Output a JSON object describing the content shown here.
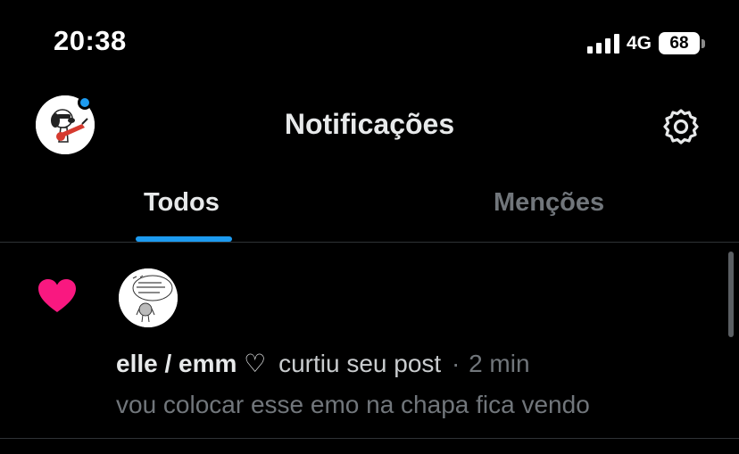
{
  "status_bar": {
    "time": "20:38",
    "network": "4G",
    "battery": "68"
  },
  "header": {
    "title": "Notificações",
    "avatar_icon": "snoopy-guitar-avatar",
    "settings_icon": "gear-icon",
    "accent_color": "#1d9bf0"
  },
  "tabs": [
    {
      "label": "Todos",
      "active": true
    },
    {
      "label": "Menções",
      "active": false
    }
  ],
  "notification": {
    "icon": "heart-icon",
    "icon_color": "#f91880",
    "avatar_text": "wow TR you look DIFFERENT today",
    "user_name": "elle / emm ♡",
    "action": "curtiu seu post",
    "separator": "·",
    "time": "2 min",
    "post_text": "vou colocar esse emo na chapa fica vendo"
  }
}
